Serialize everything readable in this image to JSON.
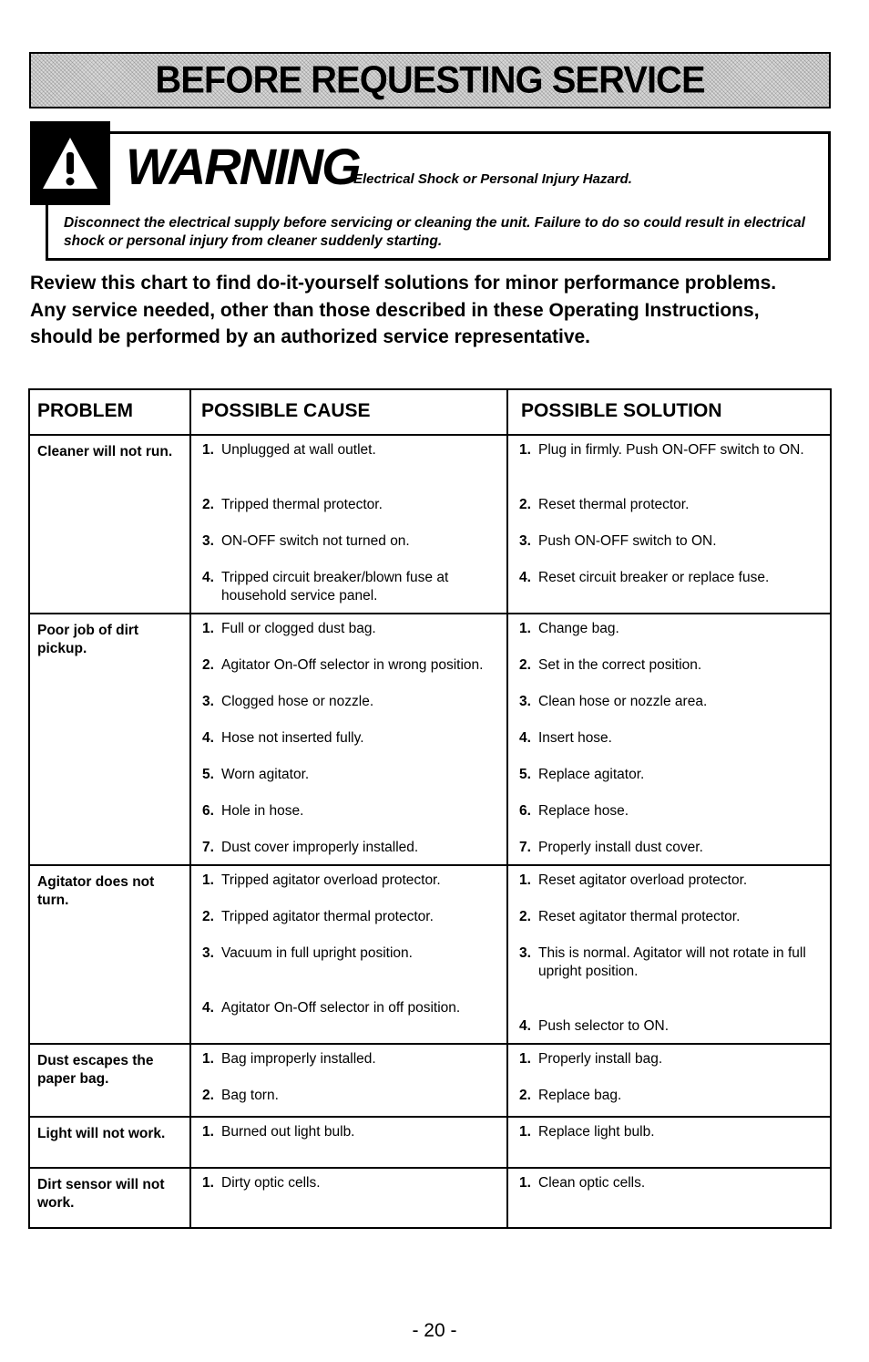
{
  "header": {
    "title": "BEFORE REQUESTING SERVICE"
  },
  "warning": {
    "icon": "warning-triangle-icon",
    "word": "WARNING",
    "subtitle": "Electrical Shock or Personal Injury Hazard.",
    "body": "Disconnect the electrical supply before servicing or cleaning the unit.  Failure to do so could result in electrical shock or personal injury from cleaner suddenly starting."
  },
  "intro": "Review this chart to find do-it-yourself solutions for minor performance problems. Any service needed, other than those described in these Operating Instructions, should be performed by an authorized service representative.",
  "table": {
    "headers": [
      "PROBLEM",
      "POSSIBLE CAUSE",
      "POSSIBLE SOLUTION"
    ],
    "rows": [
      {
        "problem": "Cleaner will not run.",
        "pairs": [
          {
            "num": "1.",
            "cause": "Unplugged at wall outlet.",
            "solution": "Plug in firmly.  Push ON-OFF switch to ON."
          },
          {
            "num": "2.",
            "cause": "Tripped thermal protector.",
            "solution": "Reset thermal protector."
          },
          {
            "num": "3.",
            "cause": "ON-OFF switch not turned on.",
            "solution": "Push ON-OFF switch to ON."
          },
          {
            "num": "4.",
            "cause": "Tripped circuit breaker/blown fuse at household service panel.",
            "solution": "Reset circuit breaker or replace fuse."
          }
        ]
      },
      {
        "problem": "Poor job of dirt pickup.",
        "pairs": [
          {
            "num": "1.",
            "cause": "Full or clogged dust bag.",
            "solution": "Change bag."
          },
          {
            "num": "2.",
            "cause": "Agitator On-Off selector in wrong position.",
            "solution": "Set in the correct position."
          },
          {
            "num": "3.",
            "cause": "Clogged hose or nozzle.",
            "solution": "Clean hose or nozzle area."
          },
          {
            "num": "4.",
            "cause": "Hose not inserted fully.",
            "solution": "Insert hose."
          },
          {
            "num": "5.",
            "cause": "Worn agitator.",
            "solution": "Replace agitator."
          },
          {
            "num": "6.",
            "cause": "Hole in hose.",
            "solution": "Replace hose."
          },
          {
            "num": "7.",
            "cause": "Dust cover improperly installed.",
            "solution": "Properly install dust cover."
          }
        ]
      },
      {
        "problem": "Agitator does not turn.",
        "pairs": [
          {
            "num": "1.",
            "cause": "Tripped agitator overload protector.",
            "solution": "Reset agitator overload protector."
          },
          {
            "num": "2.",
            "cause": "Tripped agitator thermal protector.",
            "solution": "Reset agitator thermal protector."
          },
          {
            "num": "3.",
            "cause": "Vacuum in full upright position.",
            "solution": "This is normal. Agitator will not rotate in full upright position."
          },
          {
            "num": "4.",
            "cause": "Agitator On-Off selector in off position.",
            "solution": "Push selector to ON."
          }
        ]
      },
      {
        "problem": "Dust escapes the paper bag.",
        "pairs": [
          {
            "num": "1.",
            "cause": "Bag improperly installed.",
            "solution": "Properly install bag."
          },
          {
            "num": "2.",
            "cause": "Bag torn.",
            "solution": "Replace bag."
          }
        ]
      },
      {
        "problem": "Light will not work.",
        "pairs": [
          {
            "num": "1.",
            "cause": "Burned out light bulb.",
            "solution": "Replace light bulb."
          }
        ]
      },
      {
        "problem": "Dirt sensor will not work.",
        "pairs": [
          {
            "num": "1.",
            "cause": "Dirty optic cells.",
            "solution": "Clean optic cells."
          }
        ]
      }
    ]
  },
  "footer": {
    "page_number": "- 20 -"
  }
}
